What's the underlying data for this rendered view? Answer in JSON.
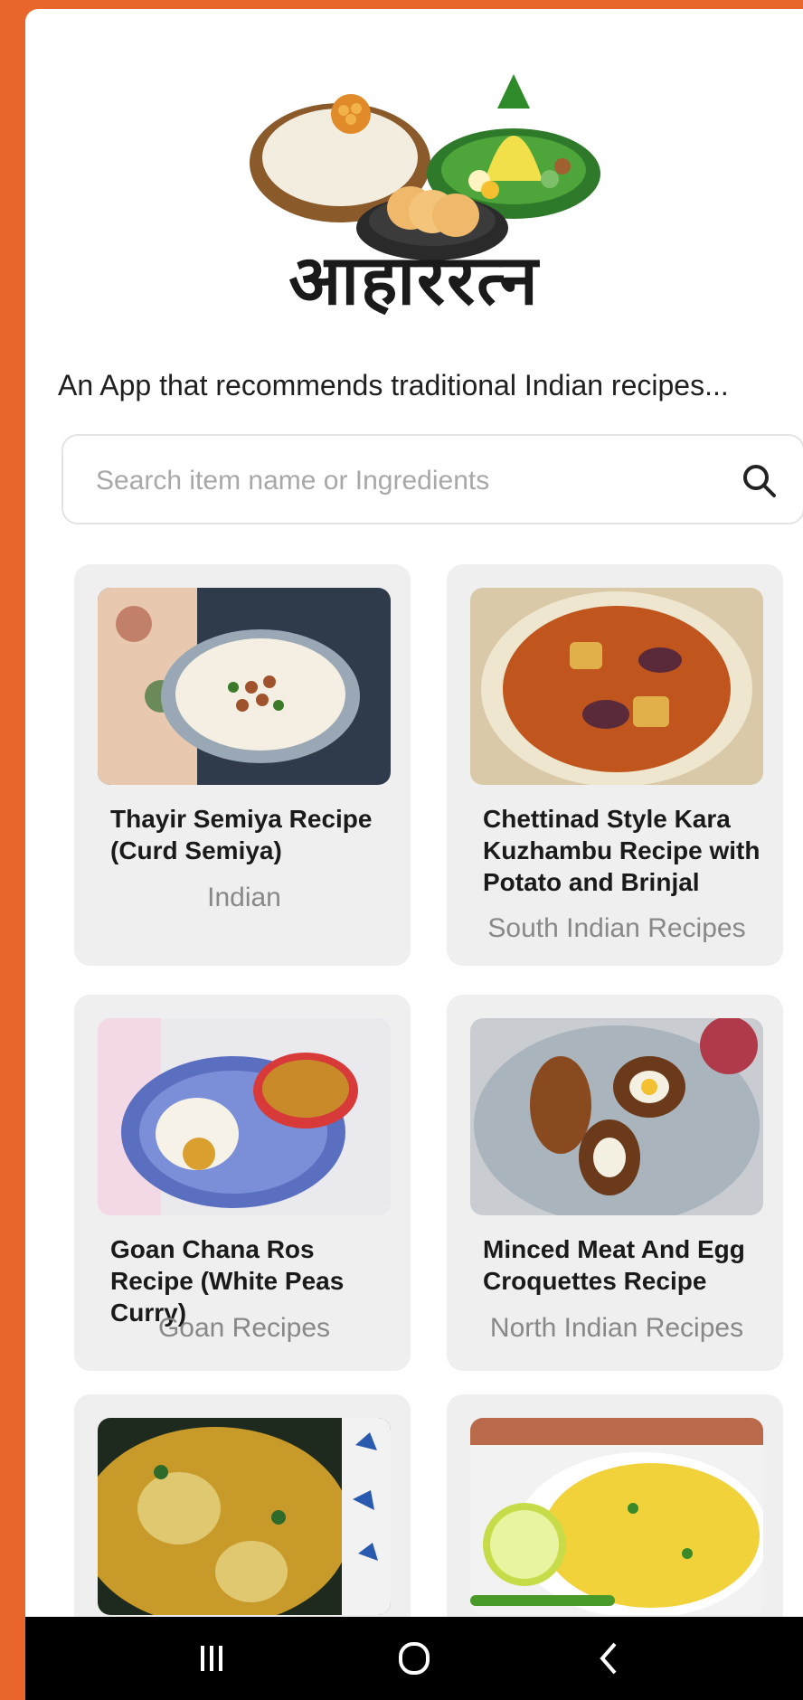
{
  "app": {
    "brand_name": "आहाररत्न",
    "tagline": "An App that recommends traditional Indian recipes..."
  },
  "search": {
    "placeholder": "Search item name or Ingredients",
    "value": "",
    "icon": "search-icon"
  },
  "recipes": [
    {
      "title": "Thayir Semiya Recipe (Curd Semiya)",
      "cuisine": "Indian"
    },
    {
      "title": "Chettinad Style Kara Kuzhambu Recipe with Potato and Brinjal",
      "cuisine": "South Indian Recipes"
    },
    {
      "title": "Goan Chana Ros Recipe (White Peas Curry)",
      "cuisine": "Goan Recipes"
    },
    {
      "title": "Minced Meat And Egg Croquettes Recipe",
      "cuisine": "North Indian Recipes"
    },
    {
      "title": "",
      "cuisine": ""
    },
    {
      "title": "",
      "cuisine": ""
    }
  ],
  "nav": {
    "recents_icon": "recents-icon",
    "home_icon": "home-icon",
    "back_icon": "back-icon"
  },
  "colors": {
    "frame": "#E8662C",
    "card_bg": "#EFEFEF",
    "cuisine_text": "#888888"
  }
}
